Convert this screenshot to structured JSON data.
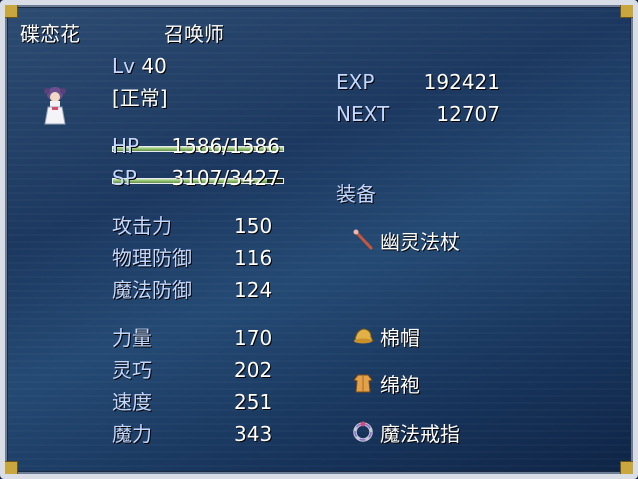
{
  "actor": {
    "name": "碟恋花",
    "class": "召唤师",
    "level_label": "Lv",
    "level": "40",
    "state": "[正常]",
    "sprite_icon": "girl-character-sprite"
  },
  "exp": {
    "exp_label": "EXP",
    "exp_value": "192421",
    "next_label": "NEXT",
    "next_value": "12707"
  },
  "hp": {
    "label": "HP",
    "text": "1586/1586",
    "fraction": 1.0,
    "color": "#8fbf6e"
  },
  "sp": {
    "label": "SP",
    "text": "3107/3427",
    "fraction": 0.907,
    "color": "#8fbf6e"
  },
  "params": [
    {
      "label": "攻击力",
      "value": "150"
    },
    {
      "label": "物理防御",
      "value": "116"
    },
    {
      "label": "魔法防御",
      "value": "124"
    },
    {
      "label": "力量",
      "value": "170"
    },
    {
      "label": "灵巧",
      "value": "202"
    },
    {
      "label": "速度",
      "value": "251"
    },
    {
      "label": "魔力",
      "value": "343"
    }
  ],
  "equipment": {
    "title": "装备",
    "items": [
      {
        "name": "幽灵法杖",
        "icon": "staff-icon"
      },
      {
        "name": "棉帽",
        "icon": "hat-icon"
      },
      {
        "name": "绵袍",
        "icon": "robe-icon"
      },
      {
        "name": "魔法戒指",
        "icon": "ring-icon"
      }
    ]
  },
  "colors": {
    "system_text": "#c4d8ff",
    "normal_text": "#ffffff",
    "gauge": "#8fbf6e"
  }
}
